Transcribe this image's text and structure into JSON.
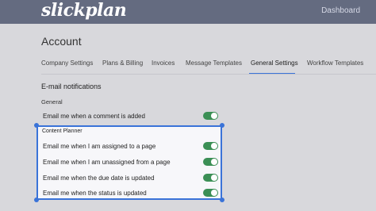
{
  "header": {
    "logo": "slickplan",
    "dashboard_label": "Dashboard"
  },
  "page": {
    "title": "Account"
  },
  "tabs": [
    {
      "label": "Company Settings",
      "active": false
    },
    {
      "label": "Plans & Billing",
      "active": false
    },
    {
      "label": "Invoices",
      "active": false
    },
    {
      "label": "Message Templates",
      "active": false
    },
    {
      "label": "General Settings",
      "active": true
    },
    {
      "label": "Workflow Templates",
      "active": false
    }
  ],
  "notifications": {
    "section_title": "E-mail notifications",
    "general": {
      "label": "General",
      "items": [
        {
          "label": "Email me when a comment is added",
          "enabled": true
        }
      ]
    },
    "content_planner": {
      "label": "Content Planner",
      "items": [
        {
          "label": "Email me when I am assigned to a page",
          "enabled": true
        },
        {
          "label": "Email me when I am unassigned from a page",
          "enabled": true
        },
        {
          "label": "Email me when the due date is updated",
          "enabled": true
        },
        {
          "label": "Email me when the status is updated",
          "enabled": true
        }
      ]
    }
  },
  "colors": {
    "topbar": "#646b80",
    "accent": "#3a73d8",
    "toggle_on": "#3b8f55"
  }
}
